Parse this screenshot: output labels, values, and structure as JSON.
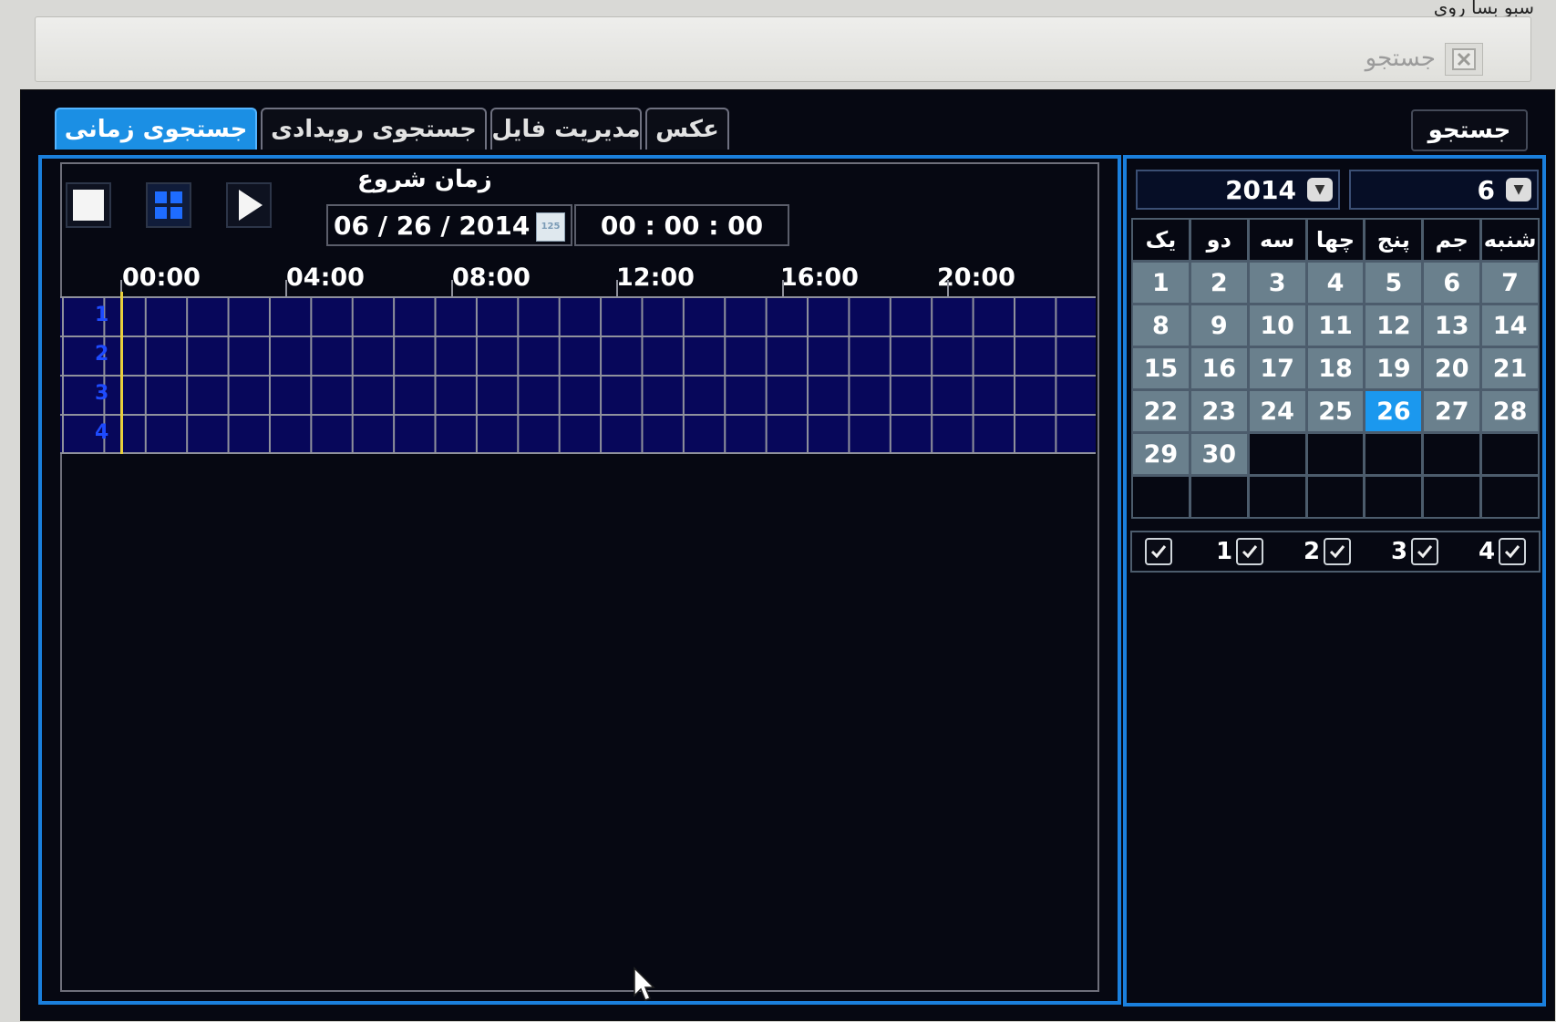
{
  "corner_text": "سبو بسا روی",
  "window": {
    "title": "جستجو"
  },
  "tabs": [
    {
      "label": "جستجوی زمانی",
      "active": true
    },
    {
      "label": "جستجوی رویدادی",
      "active": false
    },
    {
      "label": "مدیریت فایل",
      "active": false
    },
    {
      "label": "عکس",
      "active": false
    }
  ],
  "search_button": "جستجو",
  "start_time": {
    "label": "زمان شروع",
    "date": "06 / 26 / 2014",
    "time": "00 : 00 : 00",
    "calendar_icon_text": "125"
  },
  "timeline": {
    "hours": [
      "00:00",
      "04:00",
      "08:00",
      "12:00",
      "16:00",
      "20:00"
    ],
    "rows": [
      "1",
      "2",
      "3",
      "4"
    ]
  },
  "calendar": {
    "year": "2014",
    "month": "6",
    "weekdays": [
      "یک",
      "دو",
      "سه",
      "چها",
      "پنج",
      "جم",
      "شنبه"
    ],
    "selected_day": "26",
    "weeks": [
      [
        "1",
        "2",
        "3",
        "4",
        "5",
        "6",
        "7"
      ],
      [
        "8",
        "9",
        "10",
        "11",
        "12",
        "13",
        "14"
      ],
      [
        "15",
        "16",
        "17",
        "18",
        "19",
        "20",
        "21"
      ],
      [
        "22",
        "23",
        "24",
        "25",
        "26",
        "27",
        "28"
      ],
      [
        "29",
        "30",
        "",
        "",
        "",
        "",
        ""
      ],
      [
        "",
        "",
        "",
        "",
        "",
        "",
        ""
      ]
    ]
  },
  "channels": [
    "1",
    "2",
    "3",
    "4"
  ],
  "colors": {
    "accent": "#1a7fdc",
    "active_tab": "#1b8fe4",
    "timeline_fill": "#07075a",
    "cursor": "#e8cf3c",
    "day_cell": "#6a808d"
  }
}
